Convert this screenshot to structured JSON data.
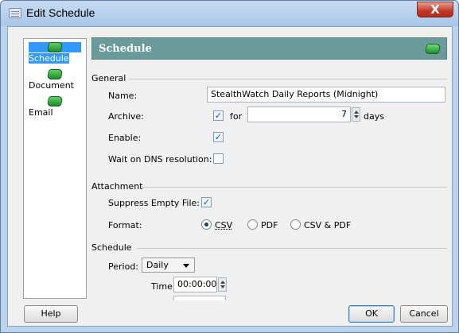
{
  "window": {
    "title": "Edit Schedule",
    "close_label": "X"
  },
  "nav": {
    "items": [
      {
        "label": "Schedule",
        "icon": "book-icon",
        "selected": true
      },
      {
        "label": "Document",
        "icon": "book-icon",
        "selected": false
      },
      {
        "label": "Email",
        "icon": "book-icon",
        "selected": false
      }
    ]
  },
  "header": {
    "title": "Schedule"
  },
  "general": {
    "section_label": "General",
    "name_label": "Name:",
    "name_value": "StealthWatch Daily Reports (Midnight)",
    "archive_label": "Archive:",
    "archive_checked": true,
    "archive_for": "for",
    "archive_value": "7",
    "archive_unit": "days",
    "enable_label": "Enable:",
    "enable_checked": true,
    "wait_label": "Wait on DNS resolution:",
    "wait_checked": false
  },
  "attachment": {
    "section_label": "Attachment",
    "suppress_label": "Suppress Empty File:",
    "suppress_checked": true,
    "format_label": "Format:",
    "options": [
      "CSV",
      "PDF",
      "CSV & PDF"
    ],
    "selected": "CSV"
  },
  "schedule": {
    "section_label": "Schedule",
    "period_label": "Period:",
    "period_value": "Daily",
    "time_label": "Time:",
    "time_value": "00:00:00"
  },
  "buttons": {
    "help": "Help",
    "ok": "OK",
    "cancel": "Cancel"
  },
  "colors": {
    "header_bg": "#6b9a9a",
    "nav_selected": "#3399ff",
    "title_bar": "#bcd3ec",
    "close_button": "#c0392b"
  }
}
